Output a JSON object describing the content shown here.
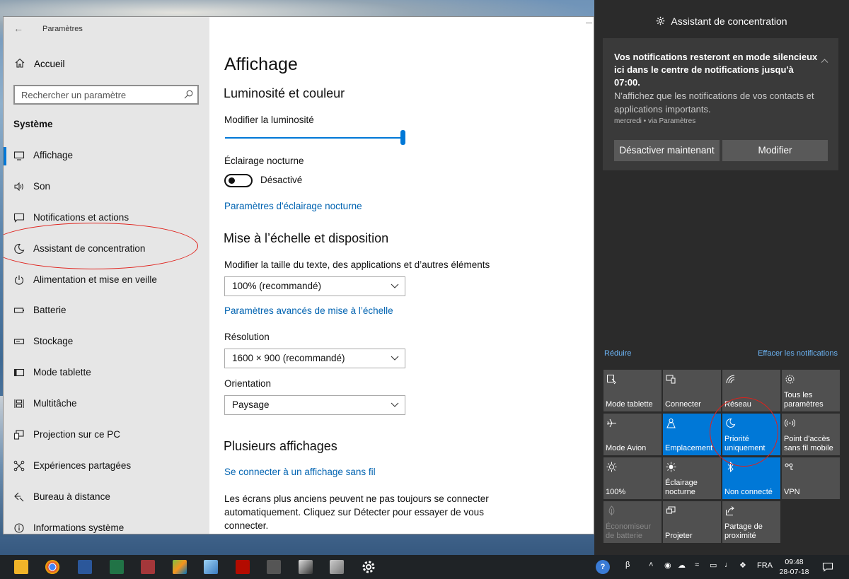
{
  "settings": {
    "app_title": "Paramètres",
    "home_label": "Accueil",
    "search_placeholder": "Rechercher un paramètre",
    "section_title": "Système",
    "nav": [
      {
        "label": "Affichage",
        "icon": "monitor-icon",
        "active": true
      },
      {
        "label": "Son",
        "icon": "speaker-icon"
      },
      {
        "label": "Notifications et actions",
        "icon": "message-icon"
      },
      {
        "label": "Assistant de concentration",
        "icon": "moon-icon"
      },
      {
        "label": "Alimentation et mise en veille",
        "icon": "power-icon"
      },
      {
        "label": "Batterie",
        "icon": "battery-icon"
      },
      {
        "label": "Stockage",
        "icon": "storage-icon"
      },
      {
        "label": "Mode tablette",
        "icon": "tablet-icon"
      },
      {
        "label": "Multitâche",
        "icon": "multitask-icon"
      },
      {
        "label": "Projection sur ce PC",
        "icon": "projection-icon"
      },
      {
        "label": "Expériences partagées",
        "icon": "shared-icon"
      },
      {
        "label": "Bureau à distance",
        "icon": "remote-icon"
      },
      {
        "label": "Informations système",
        "icon": "info-icon"
      }
    ]
  },
  "display": {
    "title": "Affichage",
    "brightness_section": "Luminosité et couleur",
    "brightness_label": "Modifier la luminosité",
    "brightness_level": 1.0,
    "night_light_label": "Éclairage nocturne",
    "night_light_state": "Désactivé",
    "night_light_link": "Paramètres d'éclairage nocturne",
    "scale_section": "Mise à l’échelle et disposition",
    "scale_label": "Modifier la taille du texte, des applications et d’autres éléments",
    "scale_value": "100% (recommandé)",
    "advanced_scale_link": "Paramètres avancés de mise à l’échelle",
    "resolution_label": "Résolution",
    "resolution_value": "1600 × 900 (recommandé)",
    "orientation_label": "Orientation",
    "orientation_value": "Paysage",
    "multi_section": "Plusieurs affichages",
    "wireless_link": "Se connecter à un affichage sans fil",
    "multi_text": "Les écrans plus anciens peuvent ne pas toujours se connecter automatiquement. Cliquez sur Détecter pour essayer de vous connecter."
  },
  "action_center": {
    "header": "Assistant de concentration",
    "notification": {
      "bold_text": "Vos notifications resteront en mode silencieux ici dans le centre de notifications jusqu'à 07:00.",
      "body_text": "N'affichez que les notifications de vos contacts et applications importants.",
      "meta": "mercredi • via Paramètres",
      "button_off": "Désactiver maintenant",
      "button_modify": "Modifier"
    },
    "collapse_link": "Réduire",
    "clear_link": "Effacer les notifications",
    "tiles": [
      {
        "label": "Mode tablette",
        "icon": "tablet-mode-icon",
        "state": "off"
      },
      {
        "label": "Connecter",
        "icon": "connect-icon",
        "state": "off"
      },
      {
        "label": "Réseau",
        "icon": "wifi-icon",
        "state": "off"
      },
      {
        "label": "Tous les paramètres",
        "icon": "gear-icon",
        "state": "off"
      },
      {
        "label": "Mode Avion",
        "icon": "airplane-icon",
        "state": "off"
      },
      {
        "label": "Emplacement",
        "icon": "location-icon",
        "state": "on"
      },
      {
        "label": "Priorité uniquement",
        "icon": "moon-icon",
        "state": "on"
      },
      {
        "label": "Point d'accès sans fil mobile",
        "icon": "hotspot-icon",
        "state": "off"
      },
      {
        "label": "100%",
        "icon": "brightness-icon",
        "state": "off"
      },
      {
        "label": "Éclairage nocturne",
        "icon": "night-light-icon",
        "state": "off"
      },
      {
        "label": "Non connecté",
        "icon": "bluetooth-icon",
        "state": "on"
      },
      {
        "label": "VPN",
        "icon": "vpn-icon",
        "state": "off"
      },
      {
        "label": "Économiseur de batterie",
        "icon": "battery-saver-icon",
        "state": "disabled"
      },
      {
        "label": "Projeter",
        "icon": "project-icon",
        "state": "off"
      },
      {
        "label": "Partage de proximité",
        "icon": "share-icon",
        "state": "off"
      }
    ]
  },
  "taskbar": {
    "apps": [
      "file-explorer-icon",
      "chrome-icon",
      "word-icon",
      "excel-icon",
      "access-icon",
      "paint-icon",
      "notepad-icon",
      "acrobat-icon",
      "app-icon",
      "app2-icon",
      "app3-icon",
      "settings-icon"
    ],
    "language": "FRA",
    "time": "09:48",
    "date": "28-07-18"
  },
  "colors": {
    "accent": "#0078d7",
    "annotation": "#e0211b",
    "action_center_bg": "#2b2b2b",
    "link": "#0063b1"
  }
}
